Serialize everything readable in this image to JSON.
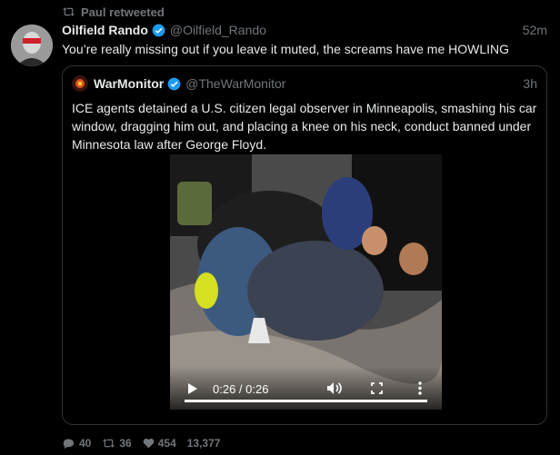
{
  "retweet": {
    "label": "Paul retweeted"
  },
  "tweet": {
    "name": "Oilfield Rando",
    "handle": "@Oilfield_Rando",
    "time": "52m",
    "text": "You’re really missing out if you leave it muted, the screams have me HOWLING"
  },
  "quote": {
    "name": "WarMonitor",
    "handle": "@TheWarMonitor",
    "time": "3h",
    "text": "ICE agents detained a U.S. citizen legal observer in Minneapolis, smashing his car window, dragging him out, and placing a knee on his neck, conduct banned under Minnesota law after George Floyd."
  },
  "video": {
    "time_display": "0:26 / 0:26",
    "progress": 1.0
  },
  "stats": {
    "replies": "40",
    "retweets": "36",
    "likes": "454",
    "views": "13,377"
  },
  "colors": {
    "verified": "#1d9bf0",
    "muted_text": "#71767b",
    "border": "#2f3336"
  }
}
